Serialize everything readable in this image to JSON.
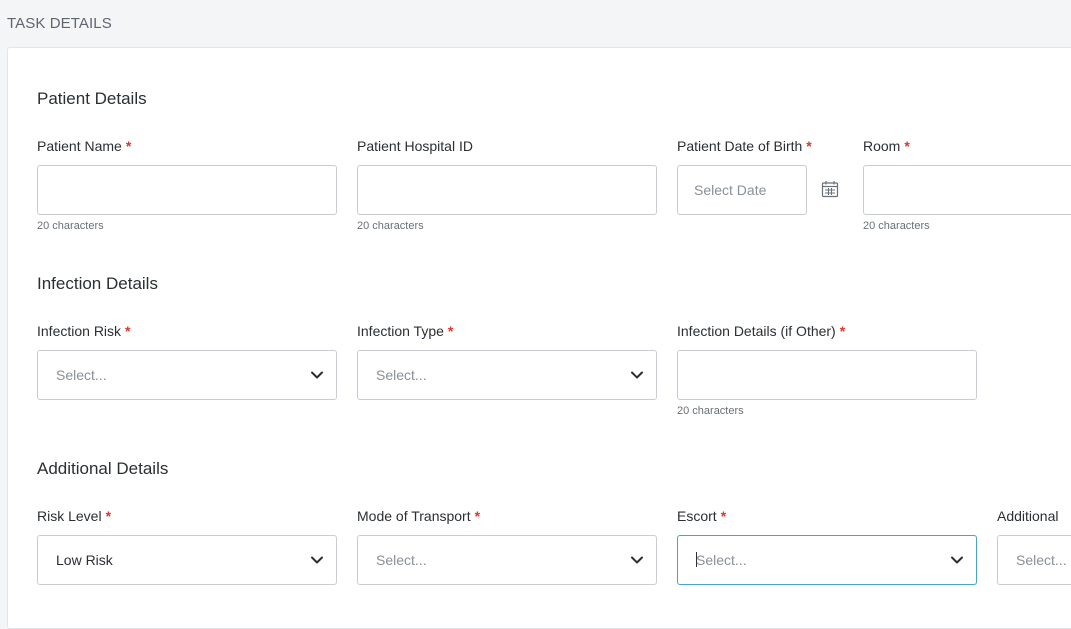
{
  "header": {
    "title": "TASK DETAILS"
  },
  "sections": {
    "patient": {
      "title": "Patient Details",
      "patient_name": {
        "label": "Patient Name",
        "required": "*",
        "value": "",
        "helper": "20 characters"
      },
      "hospital_id": {
        "label": "Patient Hospital ID",
        "value": "",
        "helper": "20 characters"
      },
      "dob": {
        "label": "Patient Date of Birth",
        "required": "*",
        "placeholder": "Select Date",
        "icon": "calendar-icon"
      },
      "room": {
        "label": "Room",
        "required": "*",
        "value": "",
        "helper": "20 characters"
      }
    },
    "infection": {
      "title": "Infection Details",
      "risk": {
        "label": "Infection Risk",
        "required": "*",
        "placeholder": "Select...",
        "icon": "chevron-down-icon"
      },
      "type": {
        "label": "Infection Type",
        "required": "*",
        "placeholder": "Select...",
        "icon": "chevron-down-icon"
      },
      "details": {
        "label": "Infection Details (if Other)",
        "required": "*",
        "value": "",
        "helper": "20 characters"
      }
    },
    "additional": {
      "title": "Additional Details",
      "risk_level": {
        "label": "Risk Level",
        "required": "*",
        "value": "Low Risk",
        "icon": "chevron-down-icon"
      },
      "transport": {
        "label": "Mode of Transport",
        "required": "*",
        "placeholder": "Select...",
        "icon": "chevron-down-icon"
      },
      "escort": {
        "label": "Escort",
        "required": "*",
        "placeholder": "Select...",
        "icon": "chevron-down-icon"
      },
      "additional": {
        "label": "Additional",
        "placeholder": "Select..."
      }
    }
  },
  "colors": {
    "required": "#d9372a",
    "focus_border": "#4aa3c7",
    "border": "#c9cdd1",
    "background": "#f4f5f7"
  }
}
